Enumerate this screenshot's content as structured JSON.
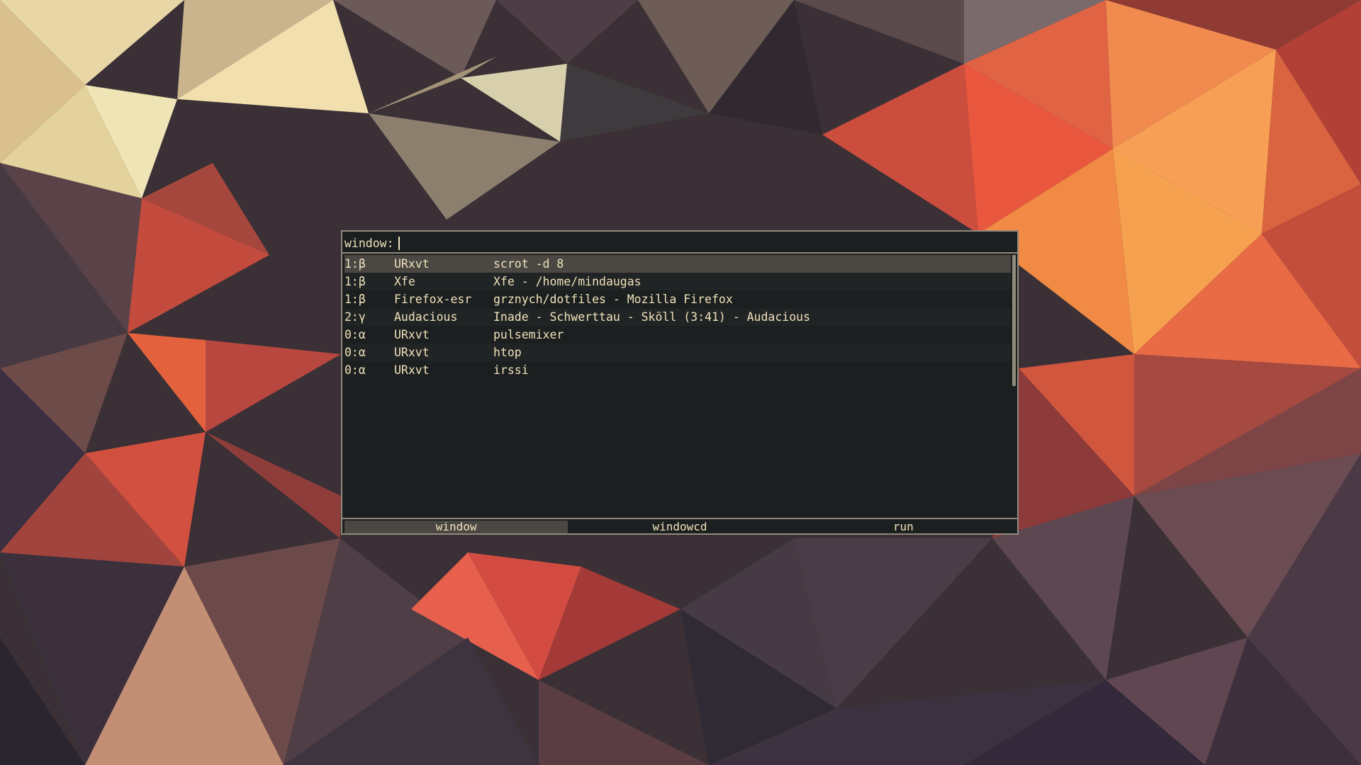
{
  "colors": {
    "background": "#1c1f1f",
    "border": "#8f8a7c",
    "text": "#efe2bc",
    "selected_row": "#4b4844",
    "alt_row": "#212424"
  },
  "prompt": {
    "label": "window:",
    "value": ""
  },
  "rows": [
    {
      "workspace": "1:β",
      "class": "URxvt",
      "title": "scrot -d 8"
    },
    {
      "workspace": "1:β",
      "class": "Xfe",
      "title": "Xfe - /home/mindaugas"
    },
    {
      "workspace": "1:β",
      "class": "Firefox-esr",
      "title": "grznych/dotfiles - Mozilla Firefox"
    },
    {
      "workspace": "2:γ",
      "class": "Audacious",
      "title": "Inade - Schwerttau - Sköll (3:41) - Audacious"
    },
    {
      "workspace": "0:α",
      "class": "URxvt",
      "title": "pulsemixer"
    },
    {
      "workspace": "0:α",
      "class": "URxvt",
      "title": "htop"
    },
    {
      "workspace": "0:α",
      "class": "URxvt",
      "title": "irssi"
    }
  ],
  "modes": [
    {
      "label": "window",
      "active": true
    },
    {
      "label": "windowcd",
      "active": false
    },
    {
      "label": "run",
      "active": false
    }
  ]
}
